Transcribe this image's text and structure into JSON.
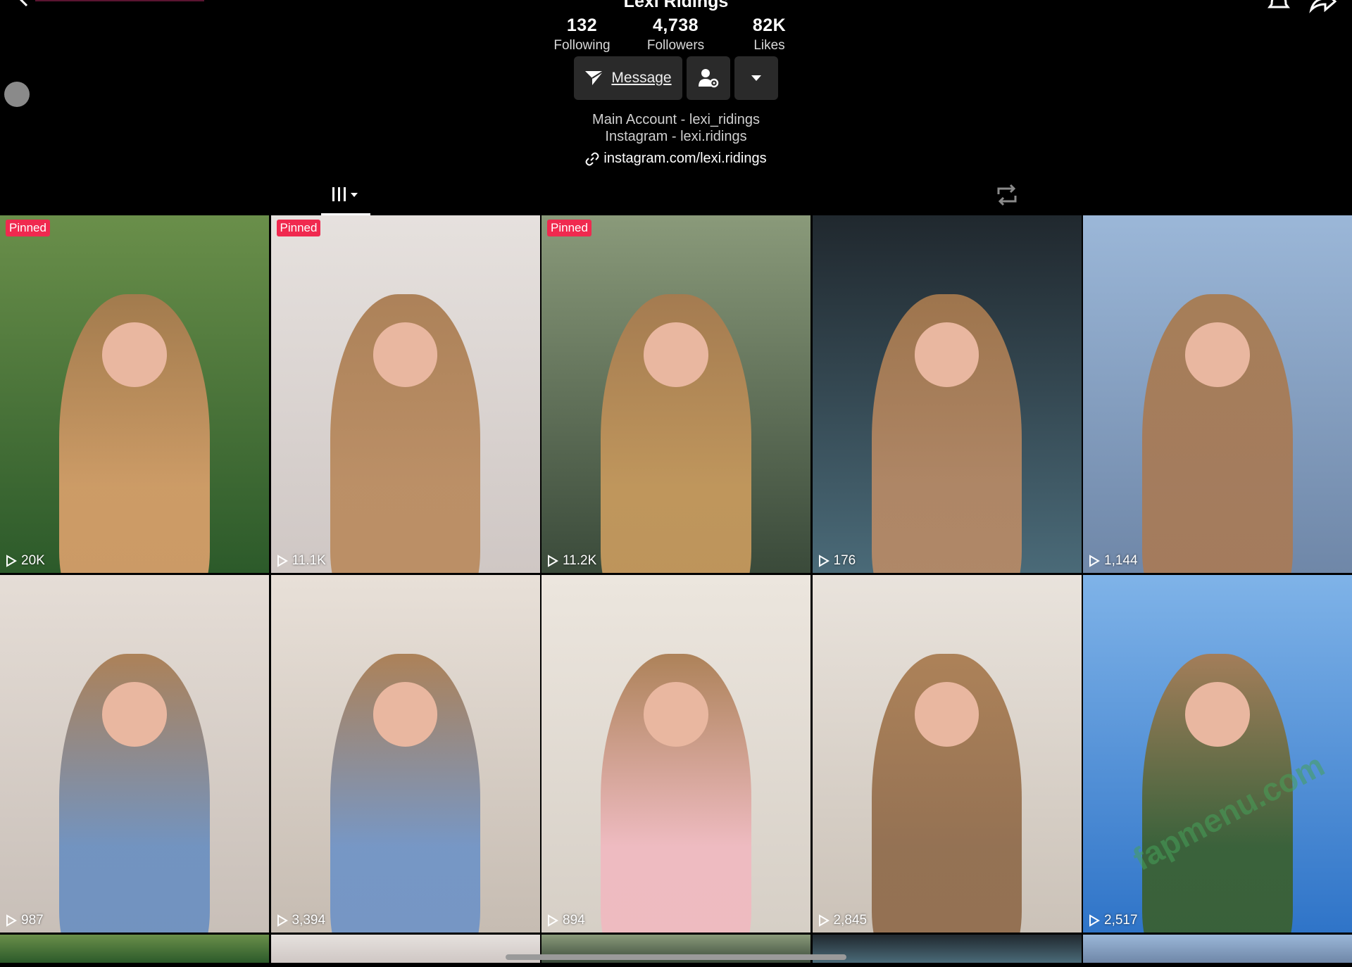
{
  "header": {
    "title": "Lexi Ridings"
  },
  "stats": [
    {
      "value": "132",
      "label": "Following"
    },
    {
      "value": "4,738",
      "label": "Followers"
    },
    {
      "value": "82K",
      "label": "Likes"
    }
  ],
  "actions": {
    "message_label": "Message"
  },
  "bio": {
    "line1": "Main Account - lexi_ridings",
    "line2": "Instagram - lexi.ridings",
    "link": "instagram.com/lexi.ridings"
  },
  "pinned_label": "Pinned",
  "videos": [
    {
      "views": "20K",
      "pinned": true
    },
    {
      "views": "11.1K",
      "pinned": true
    },
    {
      "views": "11.2K",
      "pinned": true
    },
    {
      "views": "176",
      "pinned": false
    },
    {
      "views": "1,144",
      "pinned": false
    },
    {
      "views": "987",
      "pinned": false
    },
    {
      "views": "3,394",
      "pinned": false
    },
    {
      "views": "894",
      "pinned": false
    },
    {
      "views": "2,845",
      "pinned": false
    },
    {
      "views": "2,517",
      "pinned": false
    }
  ],
  "watermark": "fapmenu.com",
  "colors": {
    "pinned_badge": "#f0294f",
    "button_bg": "#2a2a2a",
    "background": "#000000"
  }
}
